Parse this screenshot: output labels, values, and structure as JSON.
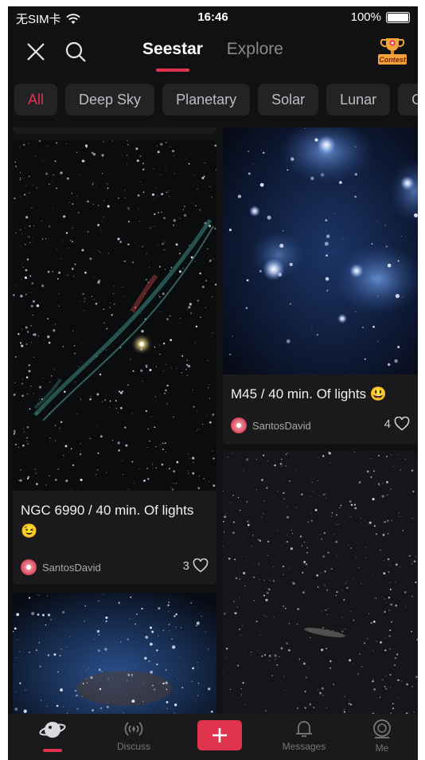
{
  "status_bar": {
    "carrier": "无SIM卡",
    "time": "16:46",
    "battery": "100%"
  },
  "nav": {
    "tabs": [
      "Seestar",
      "Explore"
    ],
    "active_tab": 0,
    "contest_label": "Contest"
  },
  "categories": {
    "items": [
      "All",
      "Deep Sky",
      "Planetary",
      "Solar",
      "Lunar",
      "O"
    ],
    "active": 0
  },
  "feed": {
    "left": [
      {
        "caption": "NGC 6990 / 40 min. Of lights",
        "emoji": "😉",
        "author": "SantosDavid",
        "likes": "3"
      }
    ],
    "right": [
      {
        "caption": "M45 / 40 min. Of lights",
        "emoji": "😃",
        "author": "SantosDavid",
        "likes": "4"
      }
    ]
  },
  "bottom_nav": {
    "items": [
      "",
      "Discuss",
      "",
      "Messages",
      "Me"
    ]
  },
  "colors": {
    "accent": "#e0344e",
    "background": "#111113",
    "card": "#1a1a1c",
    "chip": "#232326"
  }
}
